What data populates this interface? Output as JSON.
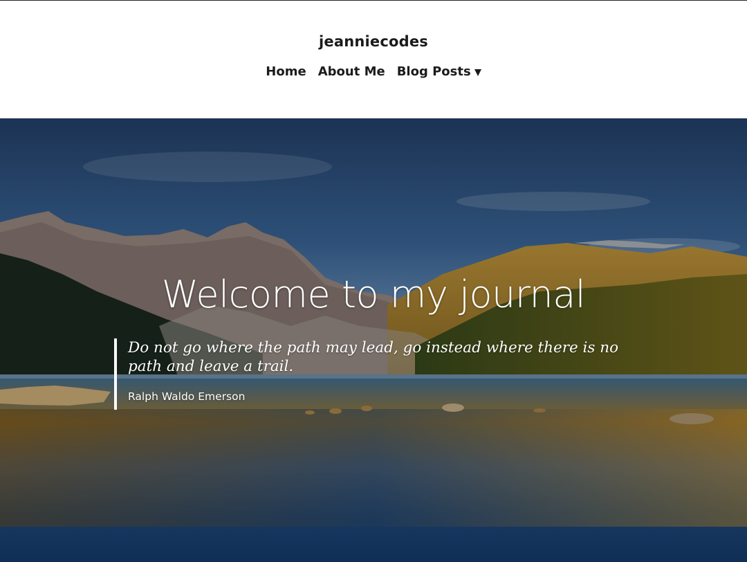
{
  "site": {
    "title": "jeanniecodes"
  },
  "nav": {
    "items": [
      {
        "label": "Home"
      },
      {
        "label": "About Me"
      },
      {
        "label": "Blog Posts",
        "icon": "caret-down-icon"
      }
    ]
  },
  "hero": {
    "title": "Welcome to my journal",
    "quote": {
      "text": "Do not go where the path may lead, go instead where there is no path and leave a trail.",
      "author": "Ralph Waldo Emerson"
    },
    "background_image": "mountain-lake-landscape"
  },
  "colors": {
    "text_dark": "#1b1b1b",
    "header_bg": "#ffffff",
    "hero_text": "#ffffff"
  }
}
